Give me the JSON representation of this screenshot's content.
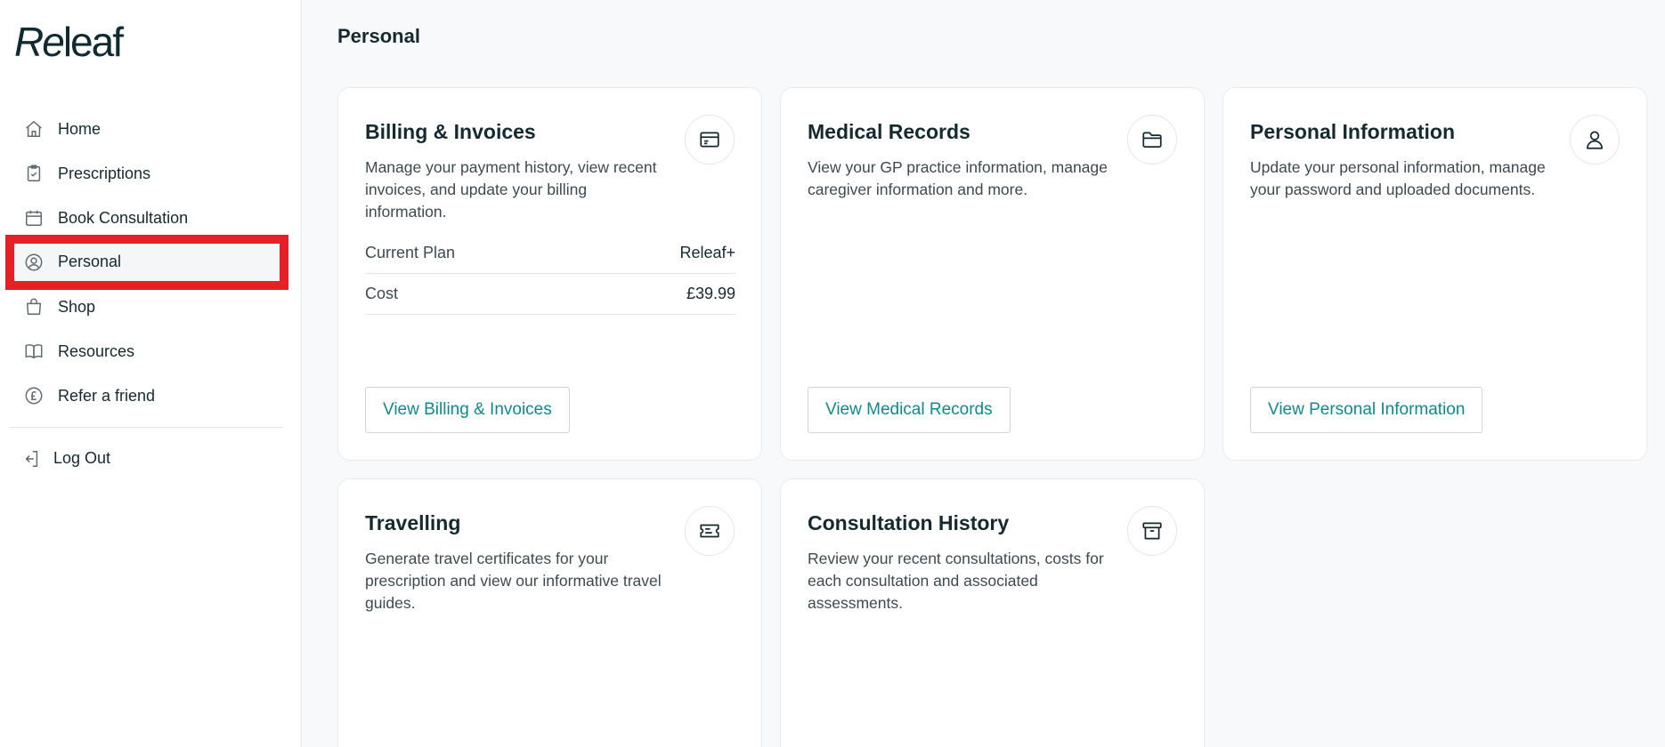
{
  "brand": {
    "logo_re": "Re",
    "logo_rest": "leaf"
  },
  "sidebar": {
    "items": [
      {
        "label": "Home",
        "icon": "home-icon"
      },
      {
        "label": "Prescriptions",
        "icon": "prescription-clipboard-icon"
      },
      {
        "label": "Book Consultation",
        "icon": "calendar-icon"
      },
      {
        "label": "Personal",
        "icon": "user-circle-icon",
        "active": true
      },
      {
        "label": "Shop",
        "icon": "shopping-bag-icon"
      },
      {
        "label": "Resources",
        "icon": "book-icon"
      },
      {
        "label": "Refer a friend",
        "icon": "pound-circle-icon"
      }
    ],
    "logout": {
      "label": "Log Out",
      "icon": "logout-icon"
    }
  },
  "page": {
    "title": "Personal"
  },
  "cards": {
    "billing": {
      "title": "Billing & Invoices",
      "description": "Manage your payment history, view recent invoices, and update your billing information.",
      "icon": "credit-card-icon",
      "rows": [
        {
          "key": "Current Plan",
          "value": "Releaf+"
        },
        {
          "key": "Cost",
          "value": "£39.99"
        }
      ],
      "button": "View Billing & Invoices"
    },
    "medical": {
      "title": "Medical Records",
      "description": "View your GP practice information, manage caregiver information and more.",
      "icon": "folder-icon",
      "button": "View Medical Records"
    },
    "personal_info": {
      "title": "Personal Information",
      "description": "Update your personal information, manage your password and uploaded documents.",
      "icon": "user-icon",
      "button": "View Personal Information"
    },
    "travelling": {
      "title": "Travelling",
      "description": "Generate travel certificates for your prescription and view our informative travel guides.",
      "icon": "ticket-icon"
    },
    "consultations": {
      "title": "Consultation History",
      "description": "Review your recent consultations, costs for each consultation and associated assessments.",
      "icon": "archive-box-icon"
    }
  },
  "colors": {
    "accent": "#0f8a8a",
    "text": "#152a2f",
    "highlight": "#e32126",
    "background": "#f8f9fa"
  }
}
